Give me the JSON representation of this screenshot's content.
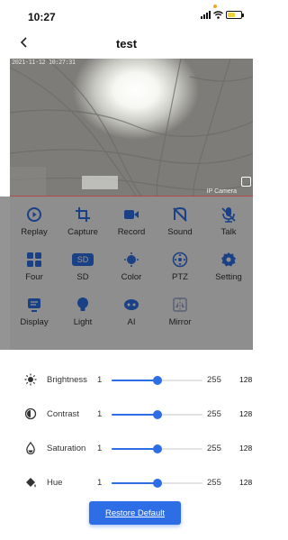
{
  "status_bar": {
    "time": "10:27"
  },
  "nav": {
    "title": "test"
  },
  "video": {
    "osd_time": "2021-11-12 10:27:31",
    "osd_name": "IP Camera"
  },
  "controls": [
    {
      "label": "Replay",
      "icon": "replay-icon"
    },
    {
      "label": "Capture",
      "icon": "crop-icon"
    },
    {
      "label": "Record",
      "icon": "video-camera-icon"
    },
    {
      "label": "Sound",
      "icon": "sound-off-icon"
    },
    {
      "label": "Talk",
      "icon": "microphone-off-icon"
    },
    {
      "label": "Four",
      "icon": "four-grid-icon"
    },
    {
      "label": "SD",
      "icon": "sd-badge",
      "badge": "SD"
    },
    {
      "label": "Color",
      "icon": "color-icon"
    },
    {
      "label": "PTZ",
      "icon": "ptz-icon"
    },
    {
      "label": "Setting",
      "icon": "gear-icon"
    },
    {
      "label": "Display",
      "icon": "display-icon"
    },
    {
      "label": "Light",
      "icon": "lightbulb-icon"
    },
    {
      "label": "AI",
      "icon": "ai-icon"
    },
    {
      "label": "Mirror",
      "icon": "mirror-icon"
    }
  ],
  "adjustments": [
    {
      "name": "Brightness",
      "icon": "sun-icon",
      "min": "1",
      "max": "255",
      "value": "128",
      "level": 128
    },
    {
      "name": "Contrast",
      "icon": "contrast-icon",
      "min": "1",
      "max": "255",
      "value": "128",
      "level": 128
    },
    {
      "name": "Saturation",
      "icon": "droplet-icon",
      "min": "1",
      "max": "255",
      "value": "128",
      "level": 128
    },
    {
      "name": "Hue",
      "icon": "paint-bucket-icon",
      "min": "1",
      "max": "255",
      "value": "128",
      "level": 128
    }
  ],
  "restore_label": "Restore Default",
  "colors": {
    "accent": "#2d6ee6",
    "overlay": "rgba(0,0,0,0.42)"
  }
}
